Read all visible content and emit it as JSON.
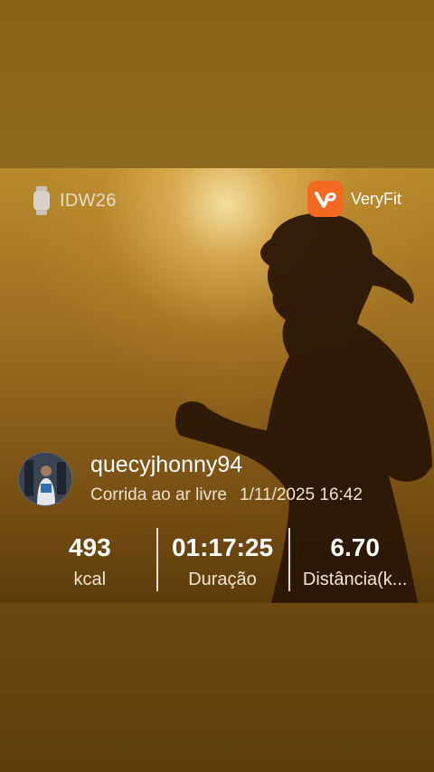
{
  "device": {
    "name": "IDW26",
    "icon": "smartwatch-icon"
  },
  "brand": {
    "name": "VeryFit",
    "logo_color": "#f26a21",
    "icon": "veryfit-logo-icon"
  },
  "user": {
    "username": "quecyjhonny94",
    "activity_type": "Corrida ao ar livre",
    "datetime": "1/11/2025 16:42"
  },
  "stats": [
    {
      "value": "493",
      "label": "kcal"
    },
    {
      "value": "01:17:25",
      "label": "Duração"
    },
    {
      "value": "6.70",
      "label": "Distância(k..."
    }
  ],
  "colors": {
    "background": "#7a5a1a",
    "text": "#ffffff"
  }
}
